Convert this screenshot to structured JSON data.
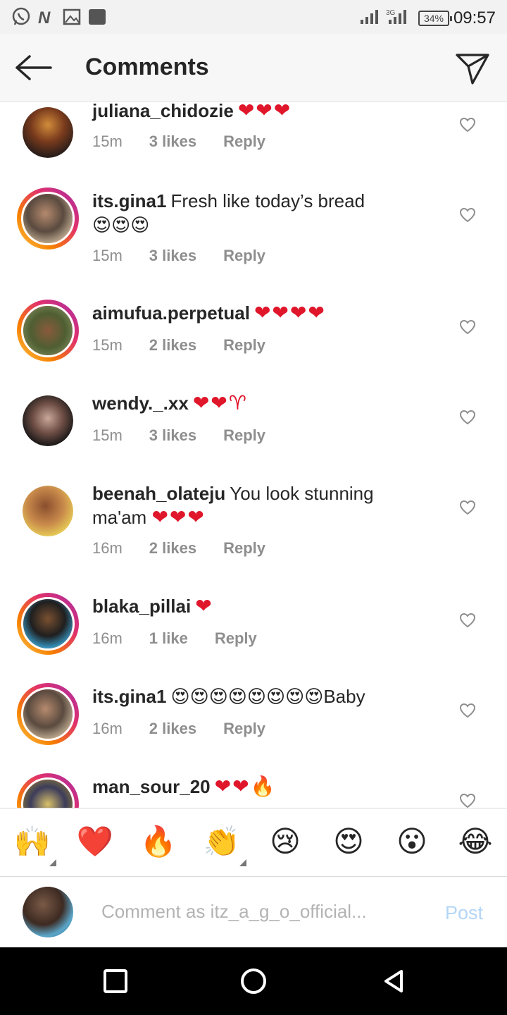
{
  "status_bar": {
    "time": "09:57",
    "battery": "34%",
    "icons": [
      "whatsapp-icon",
      "nairaland-icon",
      "gallery-icon",
      "app-icon",
      "signal-icon",
      "signal-3g-icon",
      "battery-icon"
    ]
  },
  "header": {
    "title": "Comments",
    "back_icon": "arrow-left-icon",
    "send_icon": "paper-plane-icon"
  },
  "comments": [
    {
      "username": "juliana_chidozie",
      "text": "",
      "emojis": "❤❤❤",
      "time": "15m",
      "likes": "3 likes",
      "reply": "Reply",
      "story_ring": false,
      "avatar_color": "#3b2a24"
    },
    {
      "username": "its.gina1",
      "text": "Fresh like today’s bread",
      "emojis": "😍😍😍",
      "time": "15m",
      "likes": "3 likes",
      "reply": "Reply",
      "story_ring": true,
      "avatar_color": "#6c5a4d"
    },
    {
      "username": "aimufua.perpetual",
      "text": "",
      "emojis": "❤❤❤❤",
      "time": "15m",
      "likes": "2 likes",
      "reply": "Reply",
      "story_ring": true,
      "avatar_color": "#5b6b3d"
    },
    {
      "username": "wendy._.xx",
      "text": "",
      "emojis": "❤❤♈",
      "time": "15m",
      "likes": "3 likes",
      "reply": "Reply",
      "story_ring": false,
      "avatar_color": "#4a3a36"
    },
    {
      "username": "beenah_olateju",
      "text": "You look stunning ma'am",
      "emojis": "❤❤❤",
      "time": "16m",
      "likes": "2 likes",
      "reply": "Reply",
      "story_ring": false,
      "avatar_color": "#c98a4b"
    },
    {
      "username": "blaka_pillai",
      "text": "",
      "emojis": "❤",
      "time": "16m",
      "likes": "1 like",
      "reply": "Reply",
      "story_ring": true,
      "avatar_color": "#2f4f6a"
    },
    {
      "username": "its.gina1",
      "text": "Baby",
      "emojis": "😍😍😍😍😍😍😍😍",
      "time": "16m",
      "likes": "2 likes",
      "reply": "Reply",
      "story_ring": true,
      "avatar_color": "#6c5a4d"
    },
    {
      "username": "man_sour_20",
      "text": "",
      "emojis": "❤❤🔥",
      "time": "",
      "likes": "",
      "reply": "",
      "story_ring": true,
      "avatar_color": "#3c3c5a"
    }
  ],
  "quick_emojis": [
    "🙌",
    "❤️",
    "🔥",
    "👏",
    "😢",
    "😍",
    "😮",
    "😂"
  ],
  "composer": {
    "placeholder": "Comment as itz_a_g_o_official...",
    "post_label": "Post"
  },
  "nav": {
    "icons": [
      "recents-square-icon",
      "home-circle-icon",
      "back-triangle-icon"
    ]
  },
  "colors": {
    "heart_red": "#e0162b",
    "meta_gray": "#8e8e8e",
    "post_blue": "#b3d6f7"
  }
}
